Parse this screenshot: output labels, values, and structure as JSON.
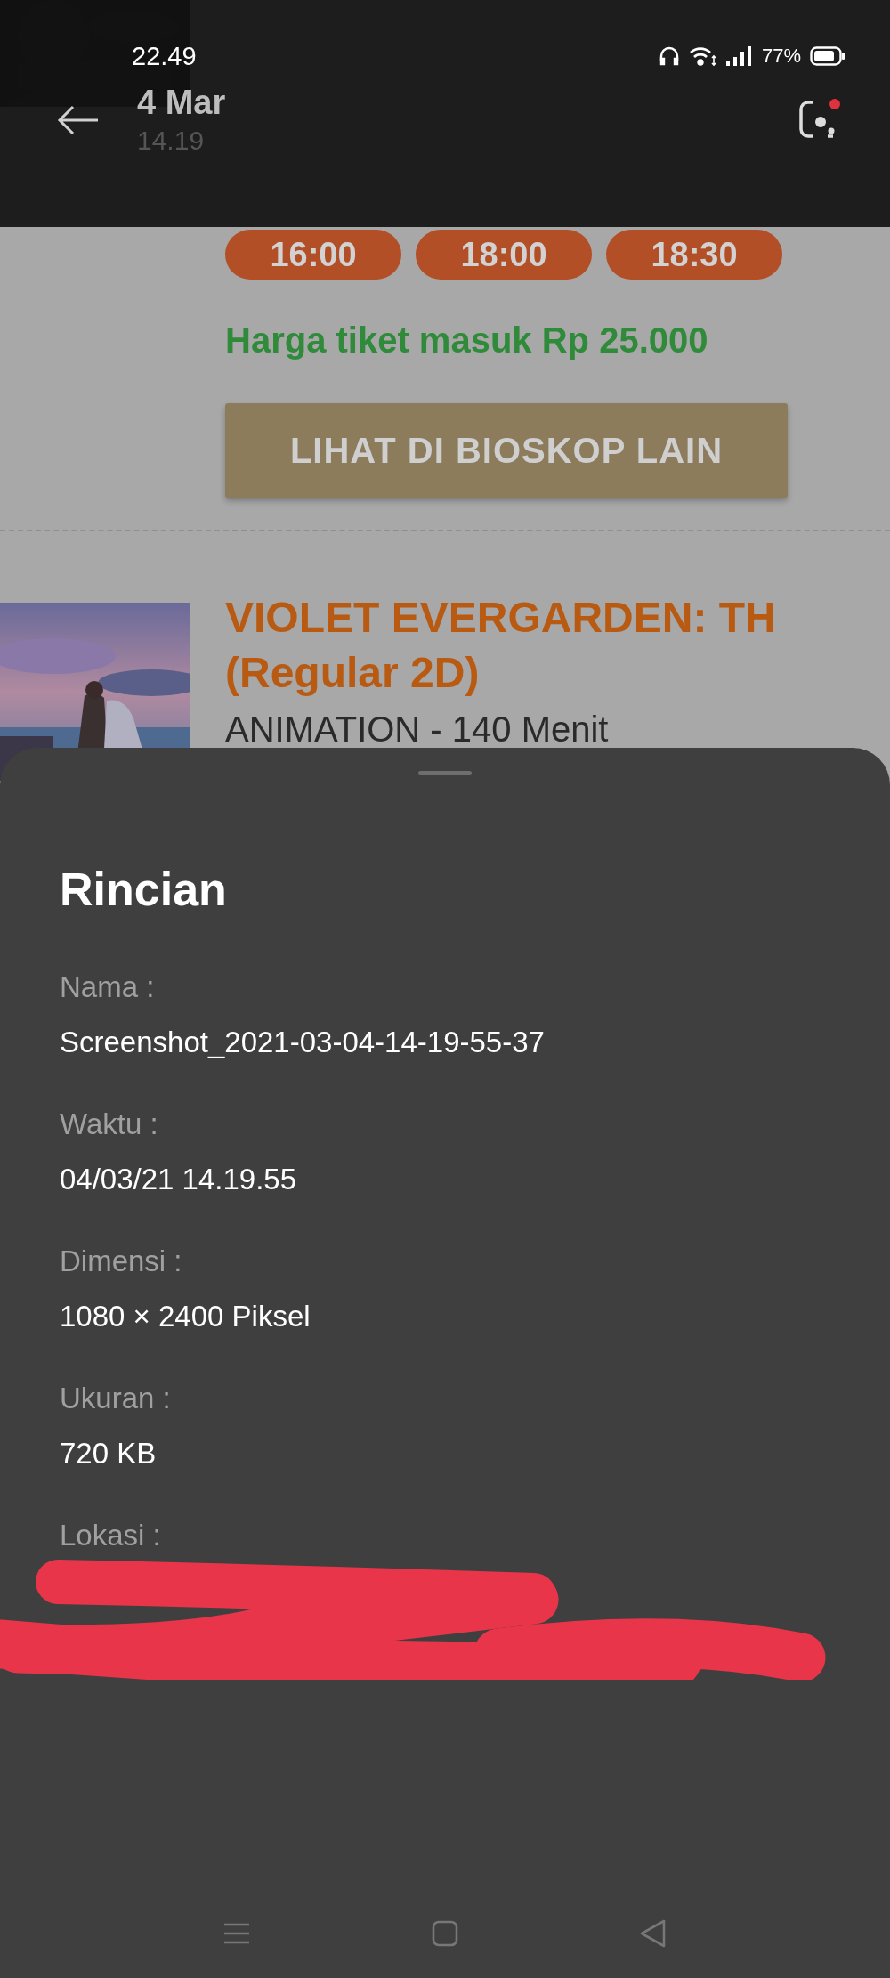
{
  "background_page": {
    "showtimes": [
      "16:00",
      "18:00",
      "18:30"
    ],
    "price": "Harga tiket masuk Rp 25.000",
    "other_cinemas_button": "LIHAT DI BIOSKOP LAIN",
    "movie": {
      "title": "VIOLET EVERGARDEN: TH",
      "format": "(Regular 2D)",
      "meta": "ANIMATION - 140 Menit"
    }
  },
  "status_bar": {
    "time": "22.49",
    "battery": "77%"
  },
  "header": {
    "date": "4 Mar",
    "time": "14.19"
  },
  "details_sheet": {
    "title": "Rincian",
    "fields": [
      {
        "label": "Nama :",
        "value": "Screenshot_2021-03-04-14-19-55-37"
      },
      {
        "label": "Waktu :",
        "value": "04/03/21 14.19.55"
      },
      {
        "label": "Dimensi :",
        "value": "1080 × 2400 Piksel"
      },
      {
        "label": "Ukuran :",
        "value": "720 KB"
      },
      {
        "label": "Lokasi :",
        "redacted": true
      }
    ]
  }
}
